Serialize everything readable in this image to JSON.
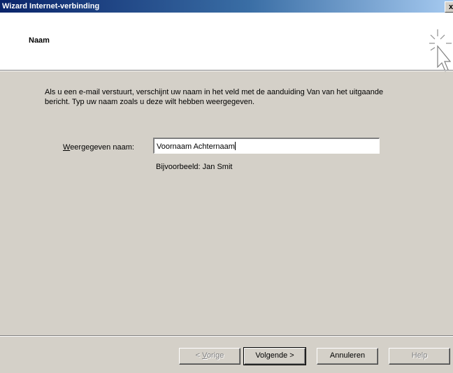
{
  "window": {
    "title": "Wizard Internet-verbinding",
    "close_label": "x"
  },
  "header": {
    "title": "Naam",
    "icon": "wizard-sparkle-cursor-icon"
  },
  "intro": {
    "text": "Als u een e-mail verstuurt, verschijnt uw naam in het veld met de aanduiding Van van het uitgaande bericht. Typ uw naam zoals u deze wilt hebben weergegeven."
  },
  "form": {
    "name_label_mnemonic": "W",
    "name_label_rest": "eergegeven naam:",
    "name_value": "Voornaam Achternaam",
    "example": "Bijvoorbeeld: Jan Smit"
  },
  "buttons": {
    "back_prefix": "< ",
    "back_mnemonic": "V",
    "back_rest": "orige",
    "next": "Volgende >",
    "cancel": "Annuleren",
    "help": "Help"
  }
}
